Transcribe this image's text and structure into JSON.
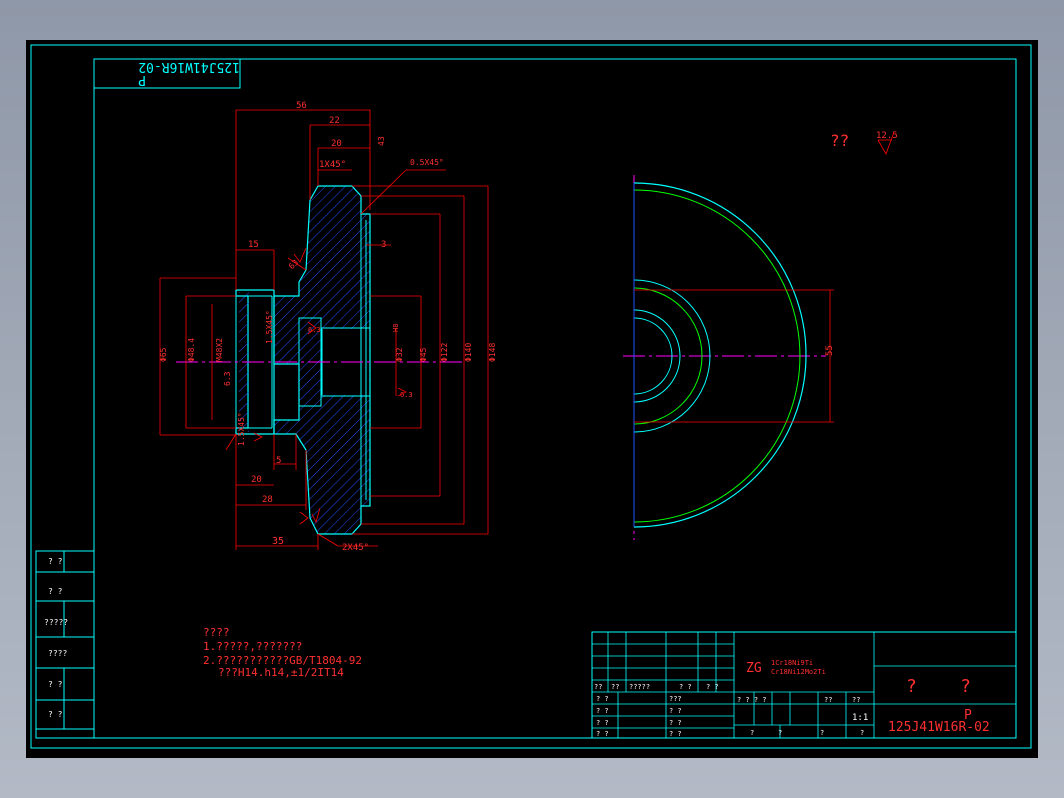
{
  "drawing": {
    "mirrored_code": "125J41W16R-02",
    "mirrored_letter": "P",
    "roughness_label": "??",
    "roughness_value": "12.5"
  },
  "dimensions": {
    "d56": "56",
    "d22": "22",
    "d20": "20",
    "d43": "43",
    "c1x45": "1X45°",
    "c05x45": "0.5X45°",
    "d15": "15",
    "d3": "3",
    "r63a": "63",
    "d65": "Φ65",
    "d484": "Φ48.4",
    "m48": "M48X2",
    "d15x45": "1.5X45°",
    "d32": "Φ32",
    "d45": "Φ45",
    "d122": "Φ122",
    "d140": "Φ140",
    "d148": "Φ148",
    "r63b": "6.3",
    "r63c": "6.3",
    "r63d": "6.3",
    "c15x45b": "1.5X45°",
    "d5": "5",
    "d20b": "20",
    "d28": "28",
    "d35": "35",
    "c2x45": "2X45°",
    "d55": "55",
    "note_h": "H8"
  },
  "notes": {
    "title": "????",
    "line1": "1.?????,???????",
    "line2": "2.???????????GB/T1804-92",
    "line3": "???H14.h14,±1/2IT14"
  },
  "left_table": [
    "? ?",
    "? ?",
    "?????",
    "????",
    "? ?",
    "? ?"
  ],
  "title_block": {
    "material_prefix": "ZG",
    "material_line1": "1Cr18Ni9Ti",
    "material_line2": "Cr18Ni12Mo2Ti",
    "name": "?    ?",
    "letter": "P",
    "code": "125J41W16R-02",
    "scale": "1:1",
    "row_a": [
      "??",
      "??",
      "?????",
      "? ?",
      "? ?"
    ],
    "sign_rows": [
      "? ?",
      "? ?",
      "? ?",
      "? ?"
    ],
    "sign_rows2": [
      "???",
      "? ?",
      "? ?",
      "? ?"
    ],
    "mid_row": [
      "? ? ? ?",
      "??",
      "??"
    ],
    "bottom_row": [
      "?",
      "?",
      "?",
      "?"
    ]
  }
}
